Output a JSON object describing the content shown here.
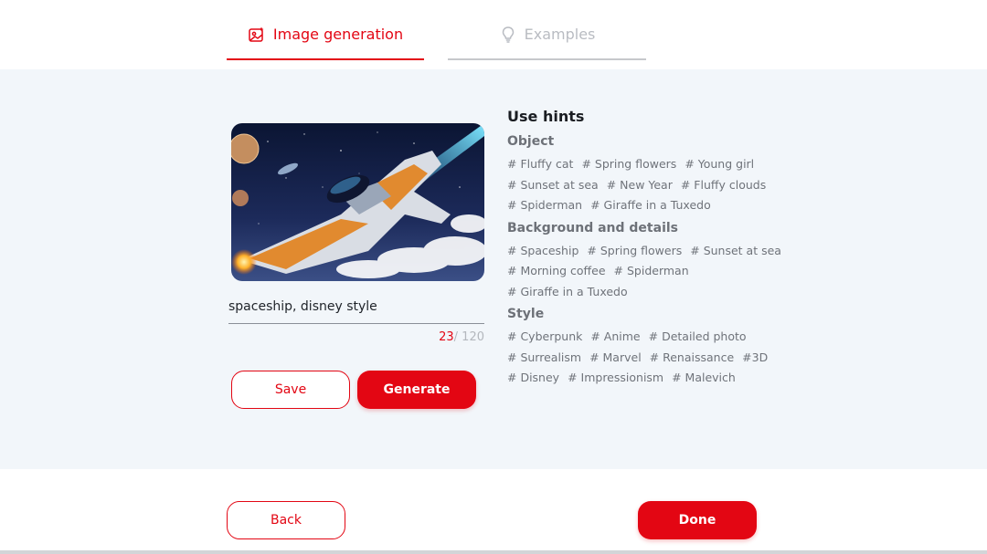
{
  "tabs": [
    {
      "label": "Image generation",
      "icon": "image-sparkle-icon",
      "active": true
    },
    {
      "label": "Examples",
      "icon": "lightbulb-icon",
      "active": false
    }
  ],
  "generator": {
    "prompt_value": "spaceship, disney style",
    "char_count": "23",
    "char_max": "/ 120",
    "save_label": "Save",
    "generate_label": "Generate"
  },
  "hints": {
    "title": "Use hints",
    "sections": [
      {
        "title": "Object",
        "rows": [
          [
            "# Fluffy cat",
            "# Spring flowers",
            "# Young girl"
          ],
          [
            "# Sunset at sea",
            "# New Year",
            "# Fluffy clouds"
          ],
          [
            "# Spiderman",
            "# Giraffe in a Tuxedo"
          ]
        ]
      },
      {
        "title": "Background and details",
        "rows": [
          [
            "# Spaceship",
            "# Spring flowers",
            "# Sunset at sea"
          ],
          [
            "# Morning coffee",
            "# Spiderman"
          ],
          [
            "# Giraffe in a Tuxedo"
          ]
        ]
      },
      {
        "title": "Style",
        "rows": [
          [
            "# Cyberpunk",
            "# Anime",
            "# Detailed photo"
          ],
          [
            "# Surrealism",
            "# Marvel",
            "# Renaissance",
            "#3D"
          ],
          [
            "# Disney",
            "# Impressionism",
            "# Malevich"
          ]
        ]
      }
    ]
  },
  "footer": {
    "back_label": "Back",
    "done_label": "Done"
  },
  "colors": {
    "accent": "#e30613",
    "panel_bg": "#f2f6fa",
    "muted_tab": "#b9bcc2"
  }
}
